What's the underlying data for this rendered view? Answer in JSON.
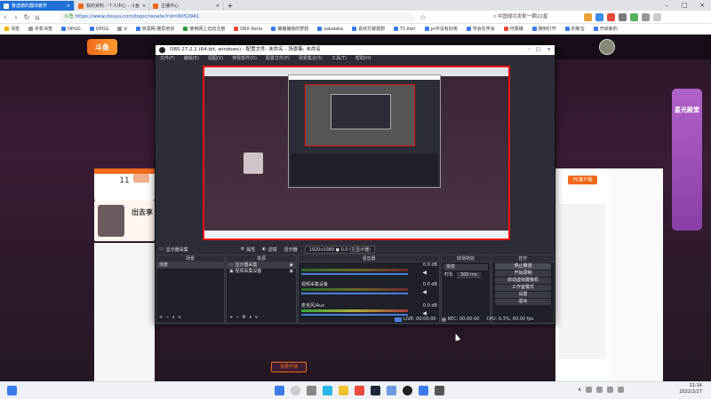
{
  "browser": {
    "tabs": [
      {
        "label": "鲁迪德的翻译教学",
        "active": true
      },
      {
        "label": "我的资料 - 个人中心 - 斗鱼",
        "active": false
      },
      {
        "label": "主播中心",
        "active": false
      }
    ],
    "url_site": "斗鱼",
    "url": "https://www.douyu.com/topic/renata?rid=6052941",
    "new_tab": "+",
    "search_label": "中国成功发射一颗22星",
    "bookmarks": [
      "书签",
      "手机书签",
      "OPGG",
      "OPGG",
      "d",
      "资源网·雅思培训",
      "使用网上迈迈注册",
      "DRX Kerla",
      "播播播我的梦想",
      "sakalaka",
      "喜欢打破猜想",
      "T1 Kerl",
      "pr中没有好用",
      "学会在学会",
      "可靠播",
      "跑到打开",
      "的新宝",
      "开启新的"
    ]
  },
  "site": {
    "logo": "斗鱼",
    "fan_count": "11",
    "room_title": "出去享",
    "right_label": "星光殿堂",
    "bottom_button": "我要开播",
    "pc_download": "PC客户端"
  },
  "obs": {
    "title": "OBS 27.2.1 (64-bit, windows) - 配置文件: 未命名 - 场景集: 未命名",
    "menu": [
      "文件(F)",
      "编辑(E)",
      "视图(V)",
      "停靠部件(D)",
      "配置文件(P)",
      "场景集合(S)",
      "工具(T)",
      "帮助(H)"
    ],
    "context_bar": {
      "source": "显示器采集",
      "props": "属性",
      "filter": "滤镜",
      "display": "显示器",
      "display_value": "1920x1080 ● 0,0 (主显示器)"
    },
    "scenes": {
      "header": "场景",
      "items": [
        "场景"
      ]
    },
    "sources": {
      "header": "来源",
      "items": [
        "显示器采集",
        "视频采集设备"
      ]
    },
    "mixer": {
      "header": "混音器",
      "tracks": [
        {
          "name": "",
          "level": "0.0 dB"
        },
        {
          "name": "视频采集设备",
          "level": "0.0 dB"
        },
        {
          "name": "麦克风/Aux",
          "level": "0.0 dB"
        }
      ]
    },
    "transitions": {
      "header": "转场特效",
      "type": "渐变",
      "duration_label": "时长",
      "duration": "300 ms"
    },
    "controls": {
      "header": "控件",
      "buttons": [
        "停止推流",
        "开始录制",
        "启动虚拟摄像机",
        "工作室模式",
        "设置",
        "退出"
      ]
    },
    "status": {
      "live": "LIVE: 00:00:00",
      "rec": "REC: 00:00:00",
      "cpu": "CPU: 0.3%, 60.00 fps"
    }
  },
  "taskbar": {
    "time": "21:14",
    "date": "2022/2/27"
  },
  "colors": {
    "obs_bg": "#2b2e38",
    "preview_border": "#e11",
    "douyu_orange": "#f26a1b",
    "tab_active": "#1f6fd6"
  }
}
